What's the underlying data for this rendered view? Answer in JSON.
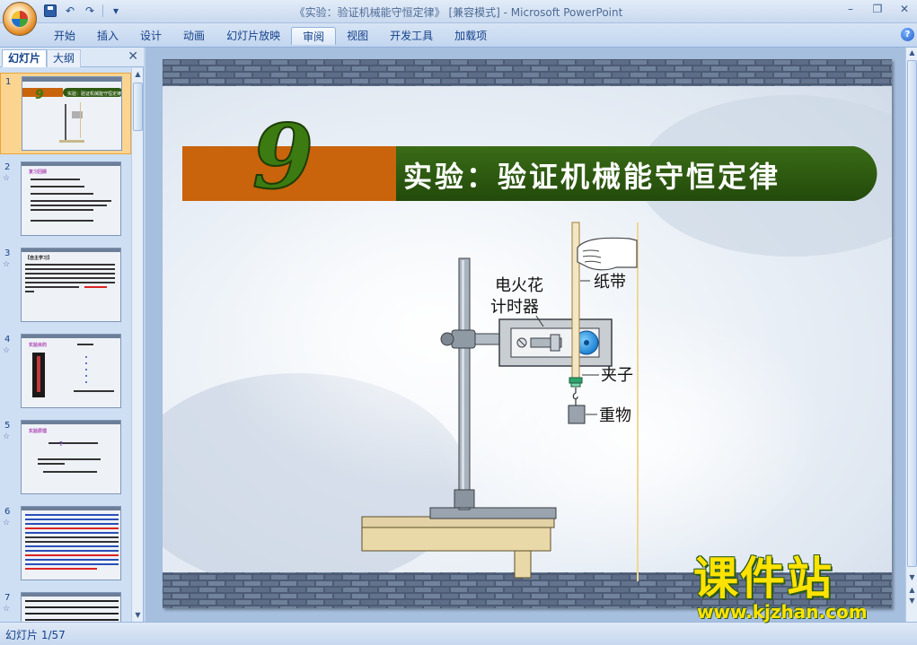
{
  "window": {
    "title": "《实验：验证机械能守恒定律》 [兼容模式] - Microsoft PowerPoint",
    "min": "–",
    "restore": "❐",
    "close": "✕"
  },
  "quick_access": {
    "undo": "↶",
    "redo": "↷",
    "customize": "▾"
  },
  "ribbon": {
    "tabs": [
      {
        "label": "开始"
      },
      {
        "label": "插入"
      },
      {
        "label": "设计"
      },
      {
        "label": "动画"
      },
      {
        "label": "幻灯片放映"
      },
      {
        "label": "审阅"
      },
      {
        "label": "视图"
      },
      {
        "label": "开发工具"
      },
      {
        "label": "加载项"
      }
    ],
    "active_tab": "审阅",
    "help": "?"
  },
  "left_pane": {
    "tabs": [
      "幻灯片",
      "大纲"
    ],
    "close": "✕",
    "slides": [
      {
        "num": "1",
        "star": "",
        "title": "实验：验证机械能守恒定律"
      },
      {
        "num": "2",
        "star": "☆",
        "title": "复习回顾"
      },
      {
        "num": "3",
        "star": "☆",
        "title": "【自主学习】"
      },
      {
        "num": "4",
        "star": "☆",
        "title": "实验目的"
      },
      {
        "num": "5",
        "star": "☆",
        "title": "实验原理"
      },
      {
        "num": "6",
        "star": "☆",
        "title": ""
      },
      {
        "num": "7",
        "star": "☆",
        "title": ""
      }
    ],
    "slide7_text": "6、由于下落高度时，我们常认为是下落距离和自由落体，实际上常将数据整理后…"
  },
  "slide": {
    "number_badge": "9",
    "title": "实验：验证机械能守恒定律",
    "labels": {
      "timer_line1": "电火花",
      "timer_line2": "计时器",
      "tape": "纸带",
      "clip": "夹子",
      "weight": "重物"
    },
    "colors": {
      "orange_band": "#c9630c",
      "green_band": "#2f5a12",
      "number_green": "#3c7a12"
    }
  },
  "status": {
    "text": "幻灯片 1/57"
  },
  "watermark": {
    "cn": "课件站",
    "url": "www.kjzhan.com"
  }
}
